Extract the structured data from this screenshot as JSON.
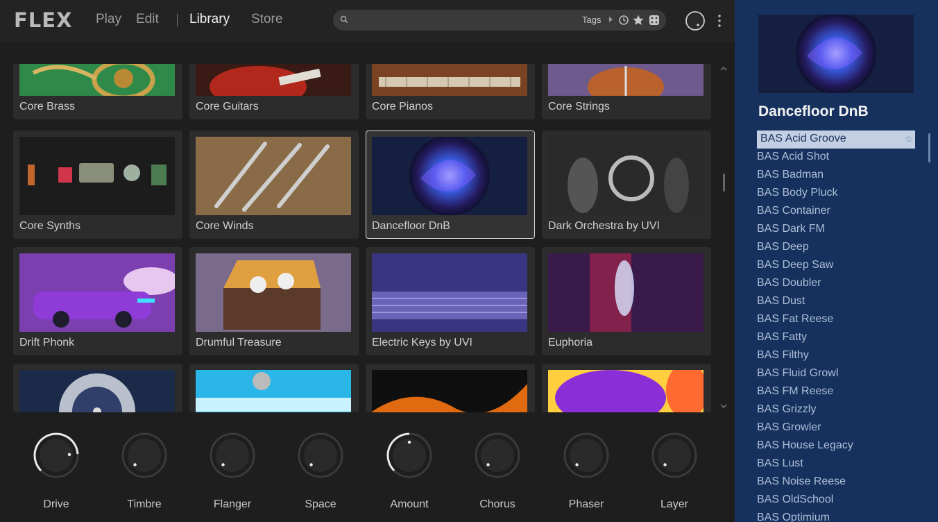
{
  "app": {
    "logo": "FLEX"
  },
  "nav": {
    "tabs": [
      {
        "label": "Play"
      },
      {
        "label": "Edit"
      },
      {
        "label": "Library"
      },
      {
        "label": "Store"
      }
    ],
    "active": "Library"
  },
  "search": {
    "placeholder": "",
    "value": "",
    "tags_label": "Tags"
  },
  "library": {
    "cards": [
      {
        "label": "Core Brass"
      },
      {
        "label": "Core Guitars"
      },
      {
        "label": "Core Pianos"
      },
      {
        "label": "Core Strings"
      },
      {
        "label": "Core Synths"
      },
      {
        "label": "Core Winds"
      },
      {
        "label": "Dancefloor DnB"
      },
      {
        "label": "Dark Orchestra by UVI"
      },
      {
        "label": "Drift Phonk"
      },
      {
        "label": "Drumful Treasure"
      },
      {
        "label": "Electric Keys by UVI"
      },
      {
        "label": "Euphoria"
      }
    ],
    "selected": "Dancefloor DnB"
  },
  "knobs": [
    {
      "label": "Drive",
      "level": 0.82
    },
    {
      "label": "Timbre",
      "level": 0.0
    },
    {
      "label": "Flanger",
      "level": 0.0
    },
    {
      "label": "Space",
      "level": 0.0
    },
    {
      "label": "Amount",
      "level": 0.5
    },
    {
      "label": "Chorus",
      "level": 0.0
    },
    {
      "label": "Phaser",
      "level": 0.0
    },
    {
      "label": "Layer",
      "level": 0.0
    }
  ],
  "panel": {
    "title": "Dancefloor DnB",
    "presets": [
      {
        "label": "BAS Acid Groove",
        "selected": true
      },
      {
        "label": "BAS Acid Shot"
      },
      {
        "label": "BAS Badman"
      },
      {
        "label": "BAS Body Pluck"
      },
      {
        "label": "BAS Container"
      },
      {
        "label": "BAS Dark FM"
      },
      {
        "label": "BAS Deep"
      },
      {
        "label": "BAS Deep Saw"
      },
      {
        "label": "BAS Doubler"
      },
      {
        "label": "BAS Dust"
      },
      {
        "label": "BAS Fat Reese"
      },
      {
        "label": "BAS Fatty"
      },
      {
        "label": "BAS Filthy"
      },
      {
        "label": "BAS Fluid Growl"
      },
      {
        "label": "BAS FM Reese"
      },
      {
        "label": "BAS Grizzly"
      },
      {
        "label": "BAS Growler"
      },
      {
        "label": "BAS House Legacy"
      },
      {
        "label": "BAS Lust"
      },
      {
        "label": "BAS Noise Reese"
      },
      {
        "label": "BAS OldSchool"
      },
      {
        "label": "BAS Optimium"
      }
    ]
  },
  "icons": {
    "search": "search-icon",
    "history": "history-icon",
    "favorites": "star-icon",
    "random": "dice-icon",
    "master": "master-volume-knob",
    "more": "more-vertical-icon",
    "star": "star-outline-icon"
  },
  "colors": {
    "accent_panel": "#16315d",
    "selected_row": "#c3d0e3",
    "background": "#1e1e1e"
  }
}
